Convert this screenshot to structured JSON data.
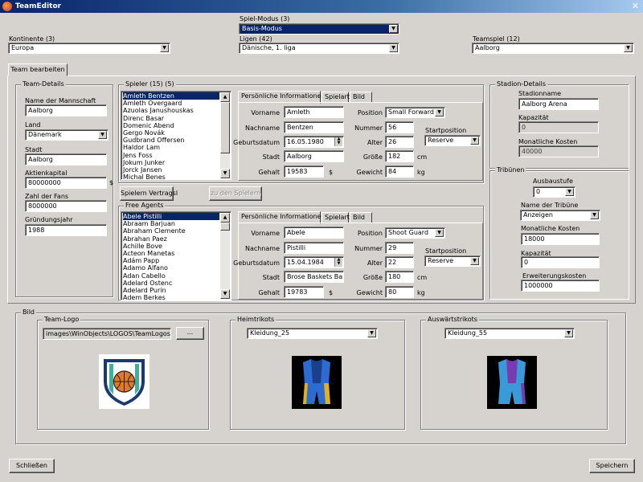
{
  "window": {
    "title": "TeamEditor",
    "close_glyph": "✕",
    "app_icon": "basketball-icon"
  },
  "top": {
    "mode_label": "Spiel-Modus (3)",
    "mode_value": "Basis-Modus",
    "continents_label": "Kontinente (3)",
    "continents_value": "Europa",
    "leagues_label": "Ligen (42)",
    "leagues_value": "Dänische, 1. liga",
    "team_label": "Teamspiel (12)",
    "team_value": "Aalborg"
  },
  "tab": {
    "label": "Team bearbeiten"
  },
  "team_details": {
    "title": "Team-Details",
    "name_label": "Name der Mannschaft",
    "name_value": "Aalborg",
    "country_label": "Land",
    "country_value": "Dänemark",
    "city_label": "Stadt",
    "city_value": "Aalborg",
    "capital_label": "Aktienkapital",
    "capital_value": "80000000",
    "currency": "$",
    "fans_label": "Zahl der Fans",
    "fans_value": "8000000",
    "founded_label": "Gründungsjahr",
    "founded_value": "1988"
  },
  "players": {
    "title": "Spieler (15) (5)",
    "items": [
      "Amleth Bentzen",
      "Amleth Overgaard",
      "Azuolas Janushouskas",
      "Direnc Basar",
      "Domenic Abend",
      "Gergo Novák",
      "Gudbrand Offersen",
      "Haldor Lam",
      "Jens Foss",
      "Jokum Junker",
      "Jorck Jansen",
      "Michal Benes"
    ],
    "selected": 0,
    "release_button": "Spielern Vertragsl",
    "to_players_button": "zu den Spielern",
    "tabs": [
      "Persönliche Informationen",
      "Spielart",
      "Bild"
    ],
    "detail": {
      "first_label": "Vorname",
      "first_value": "Amleth",
      "last_label": "Nachname",
      "last_value": "Bentzen",
      "birth_label": "Geburtsdatum",
      "birth_value": "16.05.1980",
      "city_label": "Stadt",
      "city_value": "Aalborg",
      "salary_label": "Gehalt",
      "salary_value": "19583",
      "salary_unit": "$",
      "position_label": "Position",
      "position_value": "Small Forward",
      "number_label": "Nummer",
      "number_value": "56",
      "age_label": "Alter",
      "age_value": "26",
      "height_label": "Größe",
      "height_value": "182",
      "height_unit": "cm",
      "weight_label": "Gewicht",
      "weight_value": "84",
      "weight_unit": "kg",
      "start_label": "Startposition",
      "start_value": "Reserve"
    }
  },
  "free_agents": {
    "title": "Free Agents",
    "items": [
      "Abele Pistilli",
      "Abraam Barjuan",
      "Abraham Clemente",
      "Abrahan Paez",
      "Achille Bove",
      "Acteon Manetas",
      "Adám Papp",
      "Adamo Alfano",
      "Adan Cabello",
      "Adelard Ostenc",
      "Adelard Purin",
      "Adem Berkes"
    ],
    "selected": 0,
    "tabs": [
      "Persönliche Informationen",
      "Spielart",
      "Bild"
    ],
    "detail": {
      "first_label": "Vorname",
      "first_value": "Abele",
      "last_label": "Nachname",
      "last_value": "Pistilli",
      "birth_label": "Geburtsdatum",
      "birth_value": "15.04.1984",
      "city_label": "Stadt",
      "city_value": "Brose Baskets Bam",
      "salary_label": "Gehalt",
      "salary_value": "19783",
      "salary_unit": "$",
      "position_label": "Position",
      "position_value": "Shoot Guard",
      "number_label": "Nummer",
      "number_value": "29",
      "age_label": "Alter",
      "age_value": "22",
      "height_label": "Größe",
      "height_value": "180",
      "height_unit": "cm",
      "weight_label": "Gewicht",
      "weight_value": "80",
      "weight_unit": "kg",
      "start_label": "Startposition",
      "start_value": "Reserve"
    }
  },
  "stadium": {
    "title": "Stadion-Details",
    "name_label": "Stadionname",
    "name_value": "Aalborg Arena",
    "capacity_label": "Kapazität",
    "capacity_value": "0",
    "monthly_label": "Monatliche Kosten",
    "monthly_value": "40000"
  },
  "stands": {
    "title": "Tribünen",
    "level_label": "Ausbaustufe",
    "level_value": "0",
    "name_label": "Name der Tribüne",
    "name_value": "Anzeigen",
    "monthly_label": "Monatliche Kosten",
    "monthly_value": "18000",
    "capacity_label": "Kapazität",
    "capacity_value": "0",
    "expansion_label": "Erweiterungskosten",
    "expansion_value": "1000000"
  },
  "image": {
    "title": "Bild",
    "logo_title": "Team-Logo",
    "logo_path": "images\\WinObjects\\LOGOS\\TeamLogos\\84",
    "browse_button": "...",
    "home_title": "Heimtrikots",
    "home_value": "Kleidung_25",
    "away_title": "Auswärtstrikots",
    "away_value": "Kleidung_55"
  },
  "footer": {
    "close_button": "Schließen",
    "save_button": "Speichern"
  },
  "colors": {
    "selection": "#0a246a",
    "face": "#d6d3ce",
    "titlebar": "#08246b",
    "home_jersey": "#2c6bd0",
    "away_jersey": "#3a9ad8"
  }
}
